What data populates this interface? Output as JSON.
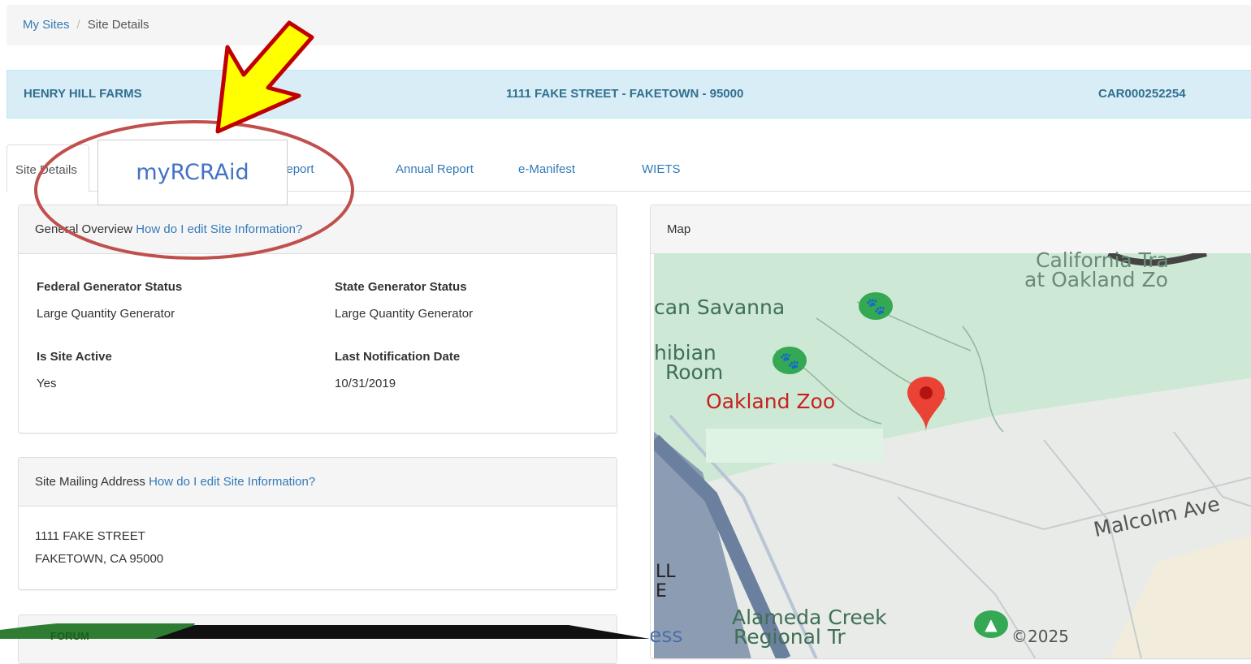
{
  "breadcrumb": {
    "root": "My Sites",
    "separator": "/",
    "current": "Site Details"
  },
  "site": {
    "name": "HENRY HILL FARMS",
    "address": "1111 FAKE STREET - FAKETOWN - 95000",
    "epa_id": "CAR000252254"
  },
  "tabs": [
    {
      "label": "Site Details",
      "active": true
    },
    {
      "label": "Biennial Report",
      "active": false
    },
    {
      "label": "Annual Report",
      "active": false
    },
    {
      "label": "e-Manifest",
      "active": false
    },
    {
      "label": "WIETS",
      "active": false
    }
  ],
  "overview": {
    "title": "General Overview",
    "help_link": "How do I edit Site Information?",
    "fields": [
      {
        "label": "Federal Generator Status",
        "value": "Large Quantity Generator"
      },
      {
        "label": "State Generator Status",
        "value": "Large Quantity Generator"
      },
      {
        "label": "Is Site Active",
        "value": "Yes"
      },
      {
        "label": "Last Notification Date",
        "value": "10/31/2019"
      }
    ]
  },
  "mailing": {
    "title": "Site Mailing Address",
    "help_link": "How do I edit Site Information?",
    "line1": "1111 FAKE STREET",
    "line2": "FAKETOWN, CA 95000"
  },
  "map": {
    "title": "Map",
    "labels": {
      "california_trail_1": "California Tra",
      "california_trail_2": "at Oakland Zo",
      "savanna": "can Savanna",
      "amphibian_1": "hibian",
      "amphibian_2": "Room",
      "zoo": "Oakland Zoo",
      "malcolm": "Malcolm Ave",
      "alameda_1": "Alameda Creek",
      "alameda_2": "Regional Tr",
      "copyright": "©2025",
      "edge_1": "LL",
      "edge_2": "E",
      "edge_3": "ess"
    }
  },
  "overlay": {
    "label": "myRCRAid"
  },
  "footer": {
    "forum_label": "FORUM"
  },
  "colors": {
    "link": "#337ab7",
    "banner_bg": "#d9edf7",
    "banner_text": "#31708f",
    "annotation_red": "#c0504d",
    "arrow_yellow": "#ffff00",
    "overlay_text": "#4472c4"
  }
}
